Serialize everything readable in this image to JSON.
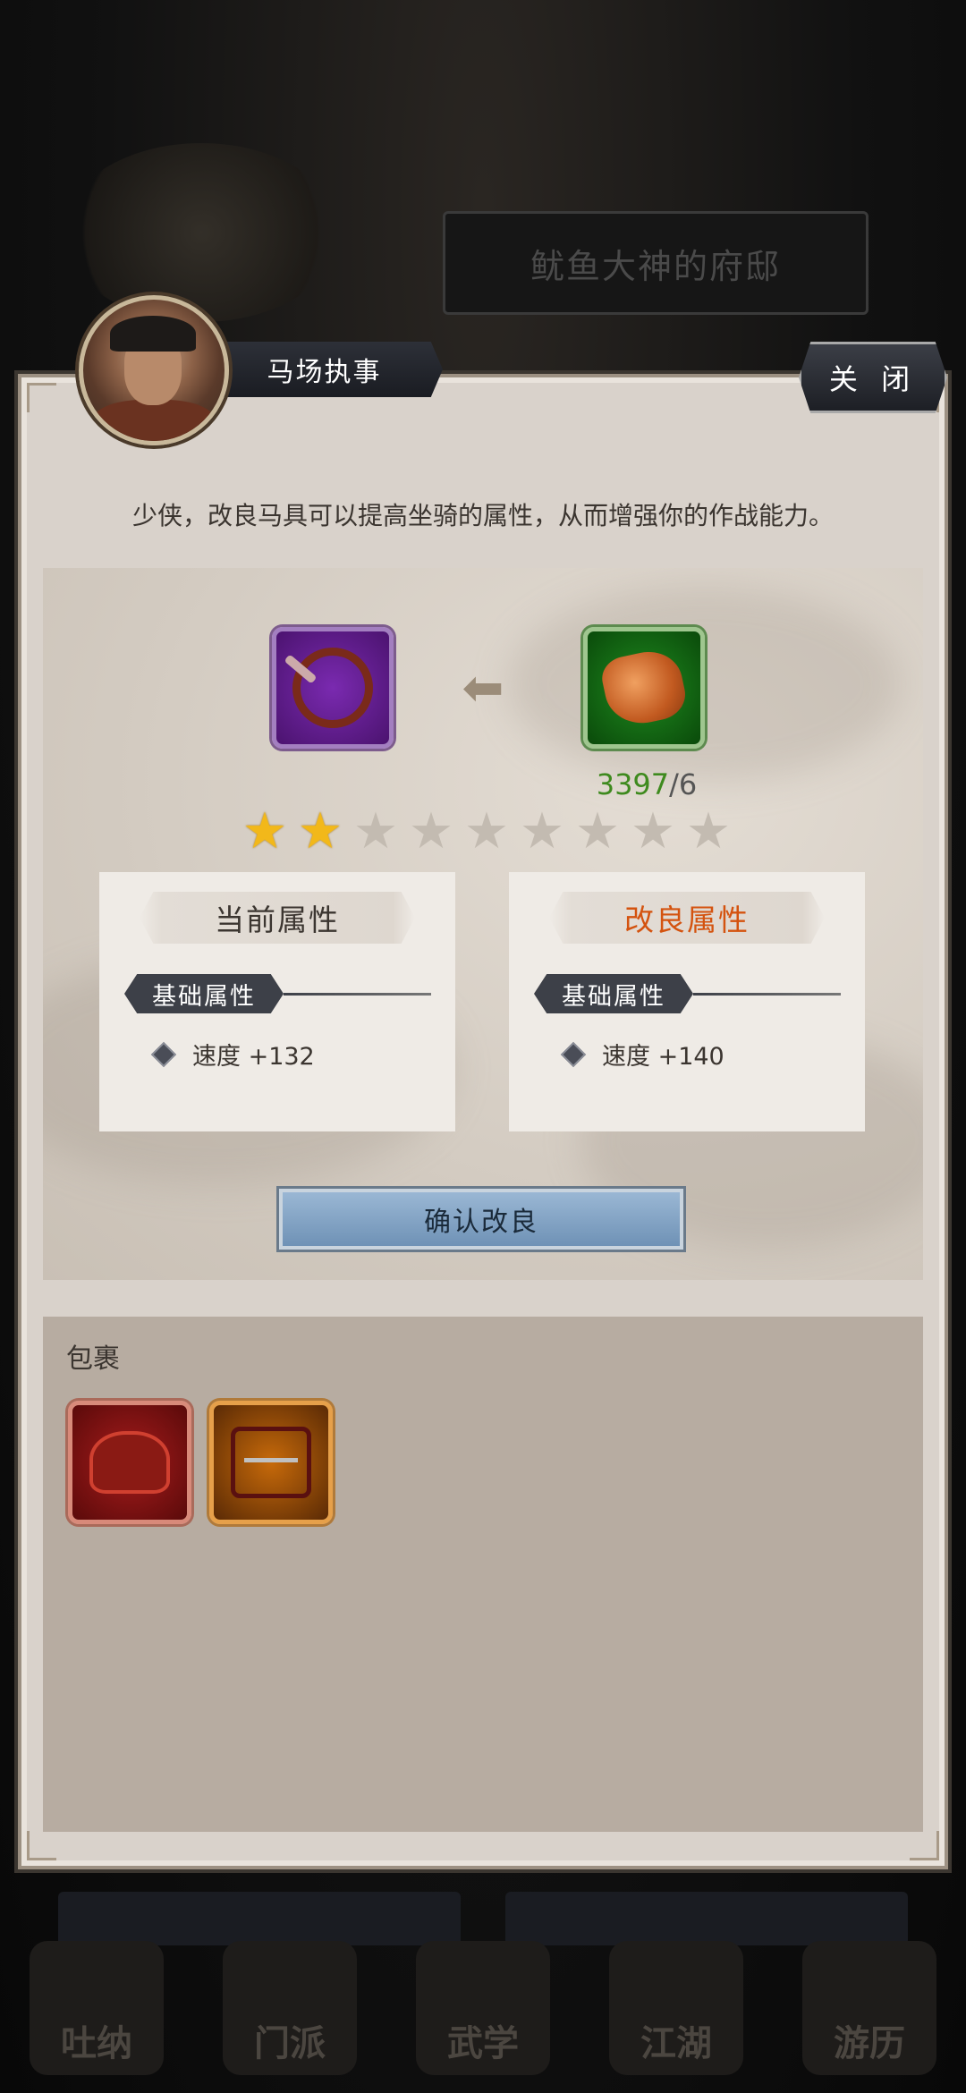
{
  "background": {
    "residence_title": "鱿鱼大神的府邸",
    "nav_items": [
      "吐纳",
      "门派",
      "武学",
      "江湖",
      "游历"
    ]
  },
  "dialog": {
    "npc_name": "马场执事",
    "close_label": "关 闭",
    "intro_text": "少侠，改良马具可以提高坐骑的属性，从而增强你的作战能力。"
  },
  "upgrade": {
    "target_item_icon": "whip-icon",
    "material_item_icon": "amber-stone-icon",
    "material_have": "3397",
    "material_need": "/6",
    "stars_total": 9,
    "stars_filled": 2,
    "current": {
      "title": "当前属性",
      "section": "基础属性",
      "stat": "速度 +132"
    },
    "improved": {
      "title": "改良属性",
      "section": "基础属性",
      "stat": "速度 +140"
    },
    "confirm_label": "确认改良"
  },
  "bag": {
    "title": "包裹",
    "items": [
      {
        "icon": "saddle-icon",
        "rarity": "red"
      },
      {
        "icon": "halter-icon",
        "rarity": "orange"
      }
    ]
  },
  "colors": {
    "improved_title": "#d4530f",
    "material_have": "#3e8a1e",
    "star_on": "#f2b81a",
    "confirm_button": "#7f9fc2"
  }
}
